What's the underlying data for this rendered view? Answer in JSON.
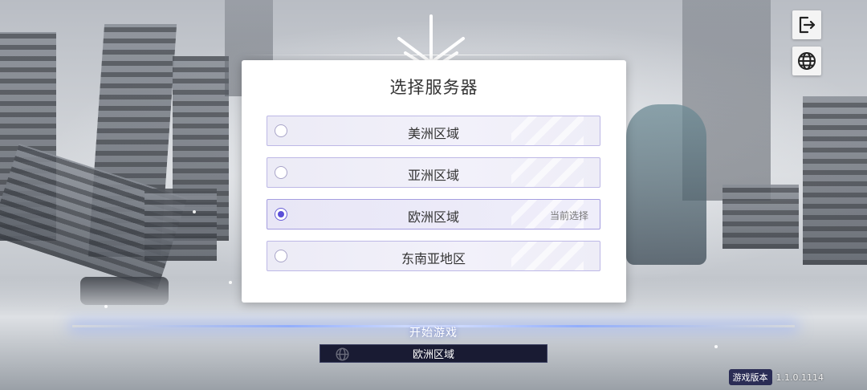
{
  "dialog": {
    "title": "选择服务器",
    "servers": [
      {
        "name": "美洲区域",
        "selected": false
      },
      {
        "name": "亚洲区域",
        "selected": false
      },
      {
        "name": "欧洲区域",
        "selected": true,
        "tag": "当前选择"
      },
      {
        "name": "东南亚地区",
        "selected": false
      }
    ]
  },
  "bottom": {
    "start_label": "开始游戏",
    "current_region": "欧洲区域"
  },
  "version": {
    "label": "游戏版本",
    "number": "1.1.0.1114"
  },
  "icons": {
    "exit": "exit-icon",
    "language": "globe-icon"
  },
  "colors": {
    "accent": "#5b4fd8",
    "region_bar": "#191b33",
    "version_badge": "#2a2c55"
  }
}
